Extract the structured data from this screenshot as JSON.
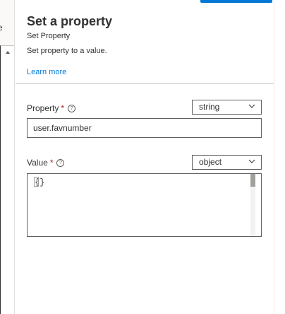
{
  "left_panel": {
    "clipped_text": "e"
  },
  "panel": {
    "title": "Set a property",
    "subtitle": "Set Property",
    "description": "Set property to a value.",
    "learn_more": "Learn more"
  },
  "property_field": {
    "label": "Property",
    "required_mark": "*",
    "type_dropdown_value": "string",
    "input_value": "user.favnumber"
  },
  "value_field": {
    "label": "Value",
    "required_mark": "*",
    "type_dropdown_value": "object",
    "editor_content": "{}"
  },
  "icons": {
    "info": "info-icon",
    "chevron": "chevron-down-icon"
  },
  "colors": {
    "accent": "#0078d4",
    "required": "#a4262c",
    "text": "#323130",
    "border": "#605e5c"
  }
}
